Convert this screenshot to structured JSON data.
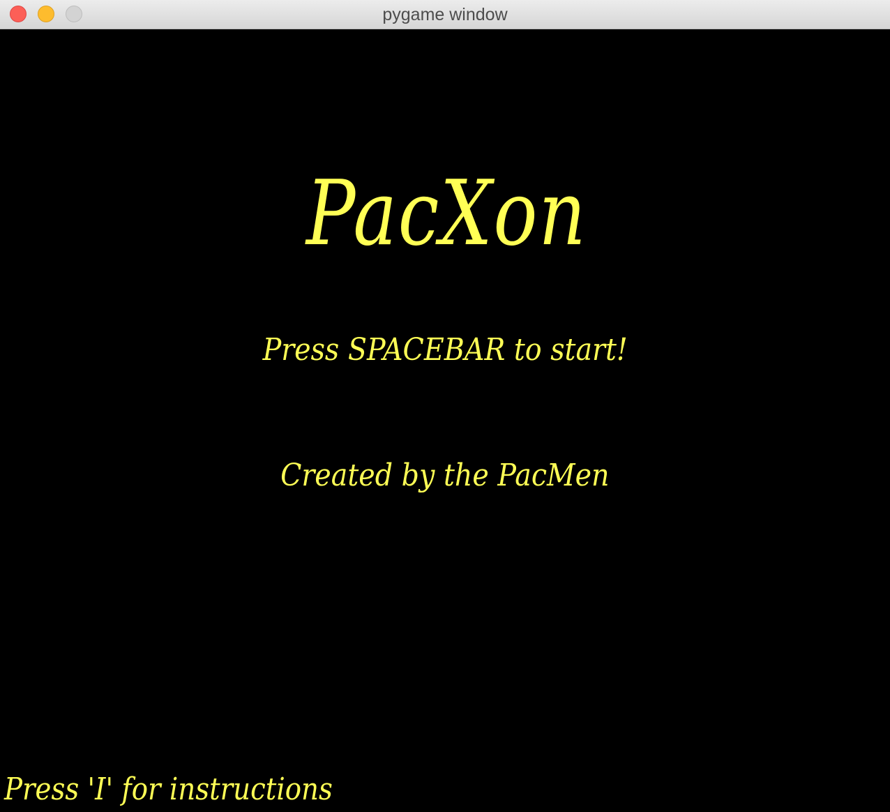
{
  "window": {
    "title": "pygame window"
  },
  "game": {
    "title": "PacXon",
    "start_prompt": "Press SPACEBAR to start!",
    "credits": "Created by the PacMen",
    "instructions_hint": "Press 'I' for instructions"
  },
  "colors": {
    "background": "#000000",
    "text": "#ffff55"
  }
}
